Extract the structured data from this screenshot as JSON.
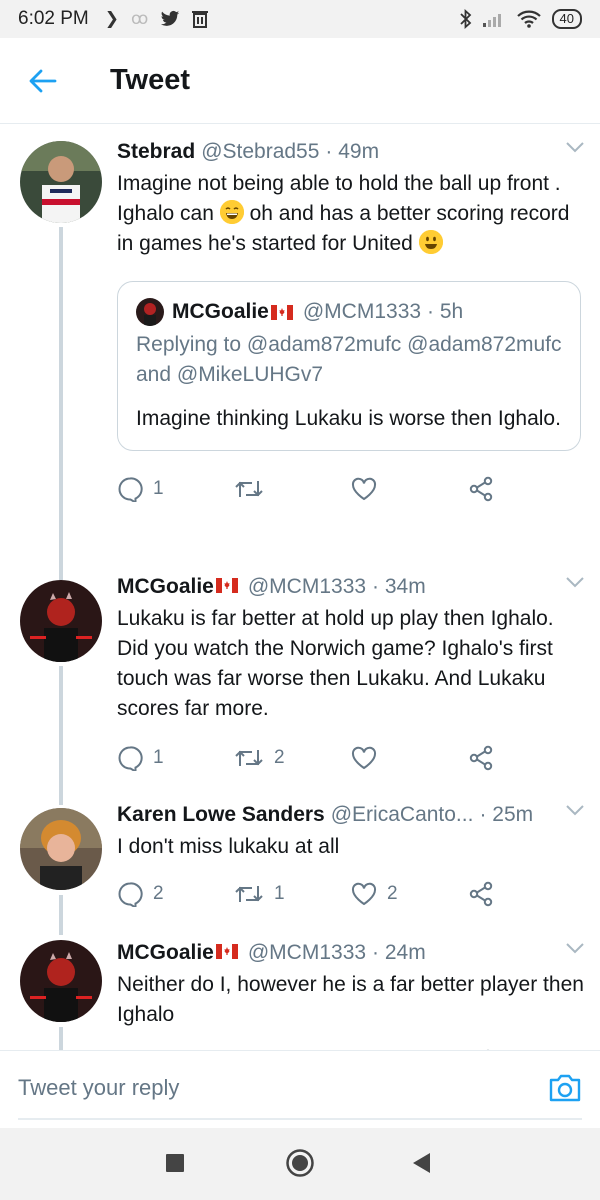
{
  "status_bar": {
    "time": "6:02 PM",
    "battery": "40"
  },
  "header": {
    "title": "Tweet"
  },
  "tweets": [
    {
      "name": "Stebrad",
      "handle": "@Stebrad55",
      "time": "· 49m",
      "text_part1": "Imagine not being able to hold the ball up front . Ighalo can",
      "text_part2": " oh and has a better scoring record in games he's started for United",
      "quote": {
        "name": "MCGoalie",
        "handle": "@MCM1333",
        "time": "· 5h",
        "replying": "Replying to @adam872mufc @adam872mufc and @MikeLUHGv7",
        "text": "Imagine thinking Lukaku is worse then Ighalo."
      },
      "replies": "1",
      "retweets": "",
      "likes": ""
    },
    {
      "name": "MCGoalie",
      "handle": "@MCM1333",
      "time": "· 34m",
      "text": "Lukaku is far better at hold up play then Ighalo. Did you watch the Norwich game? Ighalo's first touch was far worse then Lukaku. And Lukaku scores far more.",
      "replies": "1",
      "retweets": "2",
      "likes": ""
    },
    {
      "name": "Karen Lowe Sanders",
      "handle": "@EricaCanto...",
      "time": "· 25m",
      "text": "I don't miss lukaku at all",
      "replies": "2",
      "retweets": "1",
      "likes": "2"
    },
    {
      "name": "MCGoalie",
      "handle": "@MCM1333",
      "time": "· 24m",
      "text": "Neither do I, however he is a far better player then Ighalo",
      "replies": "",
      "retweets": "",
      "likes": ""
    }
  ],
  "reply_bar": {
    "placeholder": "Tweet your reply"
  },
  "colors": {
    "accent": "#1da1f2",
    "secondary_text": "#657786",
    "thread_line": "#ccd6dd"
  },
  "icons": [
    "back-arrow-icon",
    "chevron-down-icon",
    "reply-icon",
    "retweet-icon",
    "like-icon",
    "share-icon",
    "camera-icon",
    "square-nav-icon",
    "home-nav-icon",
    "back-nav-icon"
  ]
}
